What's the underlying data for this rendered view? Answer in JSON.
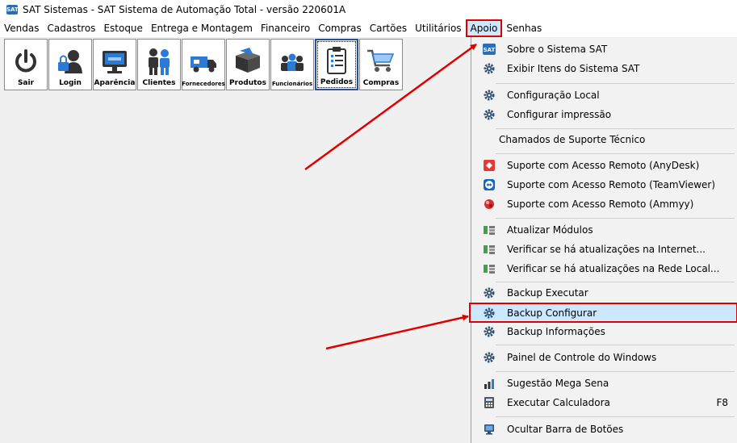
{
  "window": {
    "title": "SAT Sistemas - SAT Sistema de Automação Total - versão 220601A",
    "logo_text": "SAT"
  },
  "menubar": [
    "Vendas",
    "Cadastros",
    "Estoque",
    "Entrega e Montagem",
    "Financeiro",
    "Compras",
    "Cartões",
    "Utilitários",
    "Apoio",
    "Senhas"
  ],
  "toolbar": [
    {
      "label": "Sair",
      "icon": "power-icon"
    },
    {
      "label": "Login",
      "icon": "user-lock-icon"
    },
    {
      "label": "Aparência",
      "icon": "monitor-icon"
    },
    {
      "label": "Clientes",
      "icon": "people-icon"
    },
    {
      "label": "Fornecedores",
      "icon": "truck-icon"
    },
    {
      "label": "Produtos",
      "icon": "box-icon"
    },
    {
      "label": "Funcionários",
      "icon": "team-icon"
    },
    {
      "label": "Pedidos",
      "icon": "clipboard-icon"
    },
    {
      "label": "Compras",
      "icon": "cart-icon"
    }
  ],
  "apoio_menu": {
    "items": [
      {
        "label": "Sobre o Sistema SAT",
        "icon": "sat-logo-icon"
      },
      {
        "label": "Exibir Itens do Sistema SAT",
        "icon": "gear-icon"
      },
      {
        "label": "Configuração Local",
        "icon": "gear-icon"
      },
      {
        "label": "Configurar impressão",
        "icon": "gear-icon"
      },
      {
        "label": "Chamados de Suporte Técnico",
        "icon": ""
      },
      {
        "label": "Suporte com Acesso Remoto (AnyDesk)",
        "icon": "anydesk-icon"
      },
      {
        "label": "Suporte com Acesso Remoto (TeamViewer)",
        "icon": "teamviewer-icon"
      },
      {
        "label": "Suporte com Acesso Remoto (Ammyy)",
        "icon": "ammyy-icon"
      },
      {
        "label": "Atualizar Módulos",
        "icon": "update-icon"
      },
      {
        "label": "Verificar se há atualizações na Internet...",
        "icon": "update-icon"
      },
      {
        "label": "Verificar se há atualizações na Rede Local...",
        "icon": "update-icon"
      },
      {
        "label": "Backup Executar",
        "icon": "gear-icon"
      },
      {
        "label": "Backup Configurar",
        "icon": "gear-icon"
      },
      {
        "label": "Backup Informações",
        "icon": "gear-icon"
      },
      {
        "label": "Painel de Controle do Windows",
        "icon": "gear-icon"
      },
      {
        "label": "Sugestão Mega Sena",
        "icon": "chart-icon"
      },
      {
        "label": "Executar Calculadora",
        "icon": "calculator-icon",
        "shortcut": "F8"
      },
      {
        "label": "Ocultar Barra de Botões",
        "icon": "monitor-small-icon"
      }
    ]
  },
  "colors": {
    "highlight": "#cce8ff",
    "annotation": "#e00000",
    "gear": "#2f4f6f"
  }
}
